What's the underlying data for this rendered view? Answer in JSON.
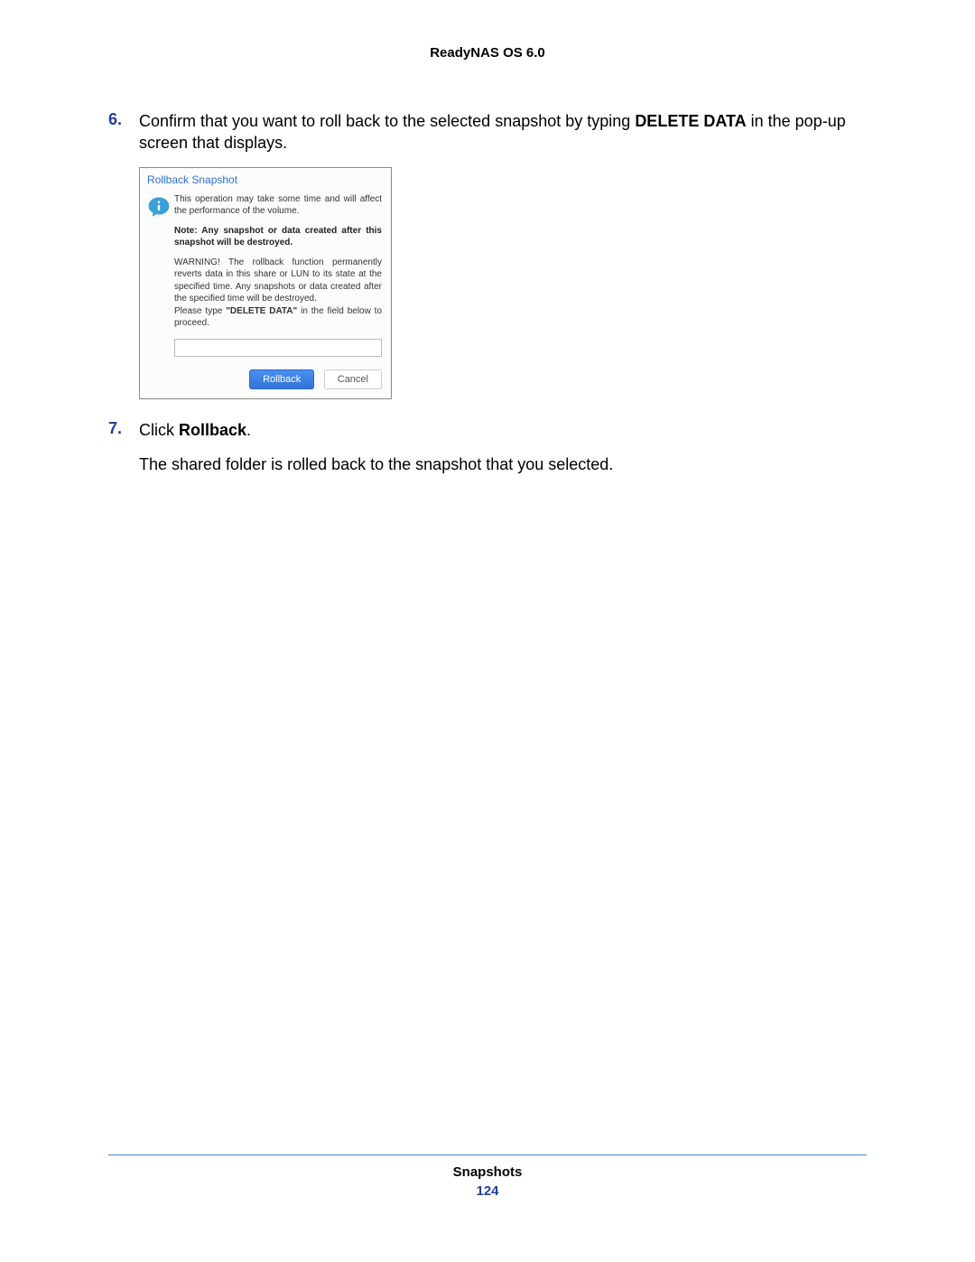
{
  "header": {
    "title": "ReadyNAS OS 6.0"
  },
  "steps": {
    "s6": {
      "num": "6.",
      "text_a": "Confirm that you want to roll back to the selected snapshot by typing ",
      "text_bold": "DELETE DATA",
      "text_b": " in the pop-up screen that displays."
    },
    "s7": {
      "num": "7.",
      "text_a": "Click ",
      "text_bold": "Rollback",
      "text_b": "."
    }
  },
  "dialog": {
    "title": "Rollback Snapshot",
    "msg1": "This operation may take some time and will affect the performance of the volume.",
    "msg2": "Note: Any snapshot or data created after this snapshot will be destroyed.",
    "msg3a": "WARNING! The rollback function permanently reverts data in this share or LUN to its state at the specified time. Any snapshots or data created after the specified time will be destroyed.",
    "msg3b_a": "Please type ",
    "msg3b_bold": "\"DELETE DATA\"",
    "msg3b_b": " in the field below to proceed.",
    "input_value": "",
    "btn_primary": "Rollback",
    "btn_secondary": "Cancel"
  },
  "after": {
    "text": "The shared folder is rolled back to the snapshot that you selected."
  },
  "footer": {
    "section": "Snapshots",
    "page": "124"
  }
}
